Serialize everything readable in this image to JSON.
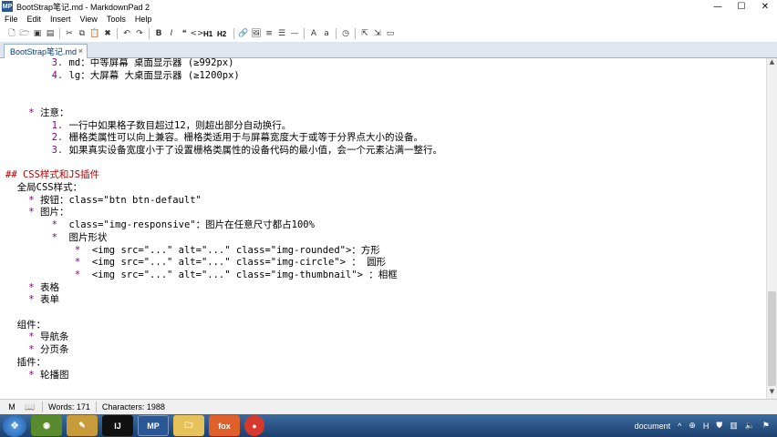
{
  "window": {
    "title": "BootStrap笔记.md - MarkdownPad 2",
    "app_icon": "MP",
    "minimize": "—",
    "maximize": "☐",
    "close": "✕"
  },
  "menu": [
    "File",
    "Edit",
    "Insert",
    "View",
    "Tools",
    "Help"
  ],
  "toolbar": {
    "buttons": [
      "new-file-icon",
      "open-folder-icon",
      "save-icon",
      "save-all-icon",
      "cut-icon",
      "copy-icon",
      "paste-icon",
      "delete-icon",
      "undo-icon",
      "redo-icon",
      "bold-icon",
      "italic-icon",
      "quote-icon",
      "code-icon",
      "h1",
      "h2",
      "link-icon",
      "image-icon",
      "ordered-list-icon",
      "unordered-list-icon",
      "horizontal-rule-icon",
      "uppercase-icon",
      "lowercase-icon",
      "timestamp-icon",
      "preview-icon",
      "export-icon",
      "toggle-preview-icon"
    ],
    "h1": "H1",
    "h2": "H2"
  },
  "tab": {
    "label": "BootStrap笔记.md",
    "close": "×"
  },
  "editor": {
    "lines": [
      {
        "indent": 0,
        "text": "        3. md：中等屏幕 桌面显示器 (≥992px)"
      },
      {
        "indent": 0,
        "text": "        4. lg：大屏幕 大桌面显示器 (≥1200px)"
      },
      {
        "indent": 0,
        "text": ""
      },
      {
        "indent": 0,
        "text": ""
      },
      {
        "indent": 0,
        "text": "    * 注意："
      },
      {
        "indent": 0,
        "text": "        1. 一行中如果格子数目超过12，则超出部分自动换行。"
      },
      {
        "indent": 0,
        "text": "        2. 栅格类属性可以向上兼容。栅格类适用于与屏幕宽度大于或等于分界点大小的设备。"
      },
      {
        "indent": 0,
        "text": "        3. 如果真实设备宽度小于了设置栅格类属性的设备代码的最小值，会一个元素沾满一整行。"
      },
      {
        "indent": 0,
        "text": ""
      },
      {
        "indent": 0,
        "text": "## CSS样式和JS插件"
      },
      {
        "indent": 0,
        "text": "  全局CSS样式："
      },
      {
        "indent": 0,
        "text": "    * 按钮：class=\"btn btn-default\""
      },
      {
        "indent": 0,
        "text": "    * 图片："
      },
      {
        "indent": 0,
        "text": "        *  class=\"img-responsive\"：图片在任意尺寸都占100%"
      },
      {
        "indent": 0,
        "text": "        *  图片形状"
      },
      {
        "indent": 0,
        "text": "            *  <img src=\"...\" alt=\"...\" class=\"img-rounded\">：方形"
      },
      {
        "indent": 0,
        "text": "            *  <img src=\"...\" alt=\"...\" class=\"img-circle\"> ： 圆形"
      },
      {
        "indent": 0,
        "text": "            *  <img src=\"...\" alt=\"...\" class=\"img-thumbnail\"> ：相框"
      },
      {
        "indent": 0,
        "text": "    * 表格"
      },
      {
        "indent": 0,
        "text": "    * 表单"
      },
      {
        "indent": 0,
        "text": ""
      },
      {
        "indent": 0,
        "text": "  组件："
      },
      {
        "indent": 0,
        "text": "    * 导航条"
      },
      {
        "indent": 0,
        "text": "    * 分页条"
      },
      {
        "indent": 0,
        "text": "  插件："
      },
      {
        "indent": 0,
        "text": "    * 轮播图"
      }
    ]
  },
  "status": {
    "words": "Words: 171",
    "characters": "Characters: 1988"
  },
  "taskbar": {
    "apps": [
      "chrome-ish-icon",
      "paint-icon",
      "idea-icon",
      "markdownpad-icon",
      "explorer-icon",
      "foxit-icon",
      "chrome-icon"
    ],
    "app_labels": {
      "idea": "IJ",
      "markdownpad": "MP",
      "foxit": "fox"
    },
    "tray_label": "document",
    "tray_h": "H"
  },
  "colors": {
    "heading": "#b20000",
    "list_marker": "#800080",
    "tab_text": "#003b7a",
    "taskbar": "#1c3f6e"
  }
}
